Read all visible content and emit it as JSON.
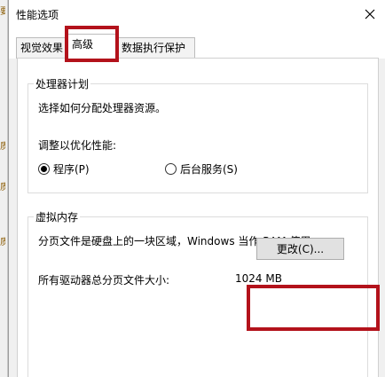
{
  "background": {
    "marks": [
      "要",
      "质",
      "质",
      "质"
    ]
  },
  "dialog": {
    "title": "性能选项",
    "tabs": [
      {
        "label": "视觉效果",
        "active": false
      },
      {
        "label": "高级",
        "active": true
      },
      {
        "label": "数据执行保护",
        "active": false
      }
    ],
    "processor": {
      "legend": "处理器计划",
      "description": "选择如何分配处理器资源。",
      "adjust_label": "调整以优化性能:",
      "options": [
        {
          "label": "程序(P)",
          "checked": true
        },
        {
          "label": "后台服务(S)",
          "checked": false
        }
      ]
    },
    "virtual_memory": {
      "legend": "虚拟内存",
      "description": "分页文件是硬盘上的一块区域，Windows 当作 RAM 使用。",
      "total_label": "所有驱动器总分页文件大小:",
      "total_value": "1024 MB",
      "change_button": "更改(C)..."
    }
  },
  "colors": {
    "highlight": "#b3121b",
    "dialog_bg": "#f0f0f0"
  }
}
